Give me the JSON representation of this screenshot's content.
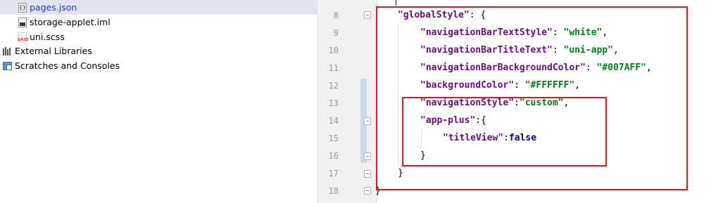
{
  "project_tree": {
    "items": [
      {
        "label": "pages.json",
        "icon": "json-file-icon",
        "selected": true
      },
      {
        "label": "storage-applet.iml",
        "icon": "iml-file-icon",
        "selected": false
      },
      {
        "label": "uni.scss",
        "icon": "sass-file-icon",
        "selected": false
      },
      {
        "label": "External Libraries",
        "icon": "external-libraries-icon",
        "selected": false
      },
      {
        "label": "Scratches and Consoles",
        "icon": "scratches-icon",
        "selected": false
      }
    ]
  },
  "editor": {
    "line_numbers": [
      "8",
      "9",
      "10",
      "11",
      "12",
      "13",
      "14",
      "15",
      "16",
      "17",
      "18"
    ],
    "lines": [
      {
        "tokens": [
          {
            "t": "\"globalStyle\"",
            "c": "k"
          },
          {
            "t": ": {",
            "c": "p"
          }
        ],
        "indent": 1
      },
      {
        "tokens": [
          {
            "t": "\"navigationBarTextStyle\"",
            "c": "k"
          },
          {
            "t": ": ",
            "c": "p"
          },
          {
            "t": "\"white\"",
            "c": "s"
          },
          {
            "t": ",",
            "c": "p"
          }
        ],
        "indent": 2
      },
      {
        "tokens": [
          {
            "t": "\"navigationBarTitleText\"",
            "c": "k"
          },
          {
            "t": ": ",
            "c": "p"
          },
          {
            "t": "\"uni-app\"",
            "c": "s"
          },
          {
            "t": ",",
            "c": "p"
          }
        ],
        "indent": 2
      },
      {
        "tokens": [
          {
            "t": "\"navigationBarBackgroundColor\"",
            "c": "k"
          },
          {
            "t": ": ",
            "c": "p"
          },
          {
            "t": "\"#007AFF\"",
            "c": "s"
          },
          {
            "t": ",",
            "c": "p"
          }
        ],
        "indent": 2
      },
      {
        "tokens": [
          {
            "t": "\"backgroundColor\"",
            "c": "k"
          },
          {
            "t": ": ",
            "c": "p"
          },
          {
            "t": "\"#FFFFFF\"",
            "c": "s"
          },
          {
            "t": ",",
            "c": "p"
          }
        ],
        "indent": 2
      },
      {
        "tokens": [
          {
            "t": "\"navigationStyle\"",
            "c": "k"
          },
          {
            "t": ":",
            "c": "p"
          },
          {
            "t": "\"custom\"",
            "c": "s"
          },
          {
            "t": ",",
            "c": "p"
          }
        ],
        "indent": 2
      },
      {
        "tokens": [
          {
            "t": "\"app-plus\"",
            "c": "k"
          },
          {
            "t": ":{",
            "c": "p"
          }
        ],
        "indent": 2
      },
      {
        "tokens": [
          {
            "t": "\"titleView\"",
            "c": "k"
          },
          {
            "t": ":",
            "c": "p"
          },
          {
            "t": "false",
            "c": "kw"
          }
        ],
        "indent": 3
      },
      {
        "tokens": [
          {
            "t": "}",
            "c": "p"
          }
        ],
        "indent": 2
      },
      {
        "tokens": [
          {
            "t": "}",
            "c": "p"
          }
        ],
        "indent": 1
      },
      {
        "tokens": [
          {
            "t": "}",
            "c": "p"
          }
        ],
        "indent": 0
      }
    ]
  },
  "colors": {
    "highlight_box": "#e8141b",
    "selection_bg": "#dfe4ee",
    "json_key": "#660e7a",
    "json_string": "#067d17",
    "json_keyword": "#000080"
  }
}
